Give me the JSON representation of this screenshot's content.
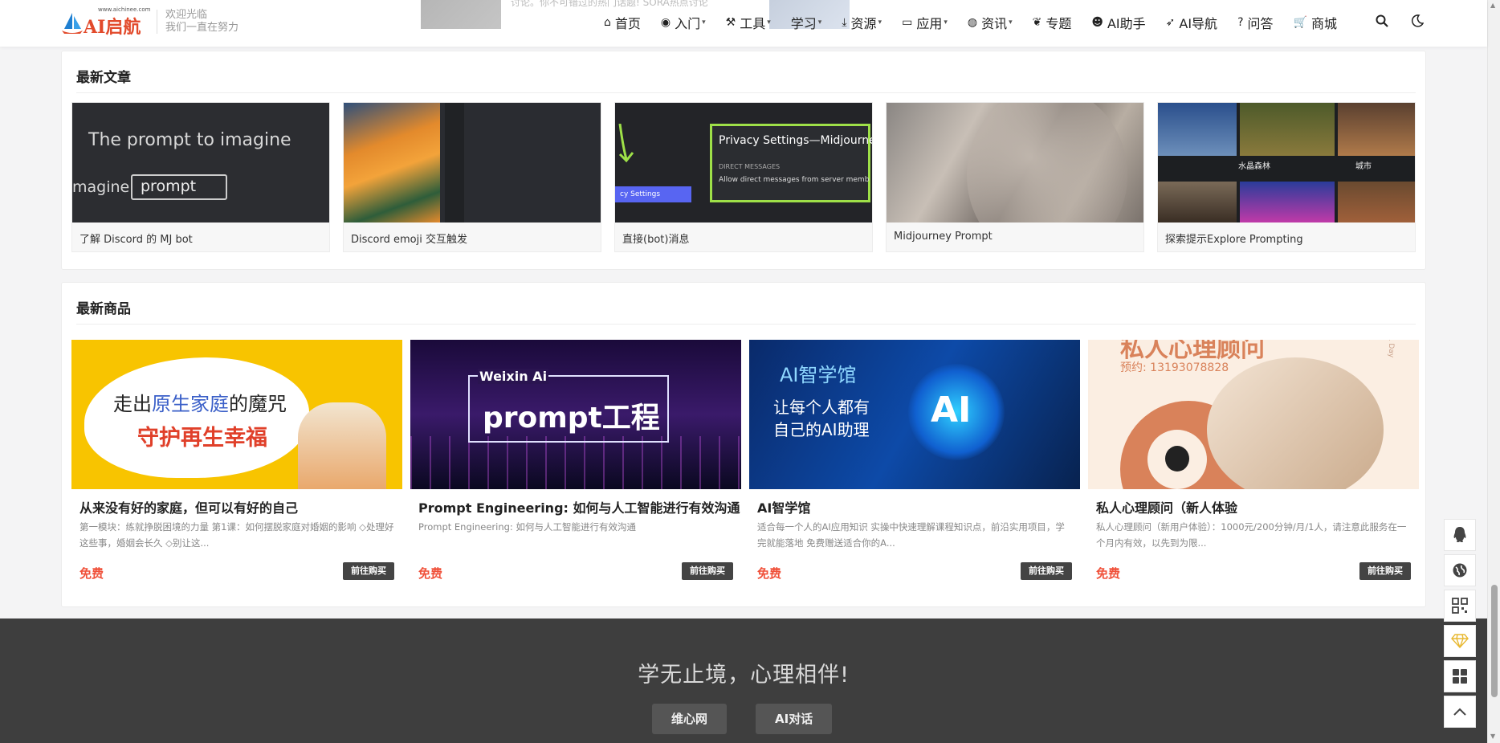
{
  "header": {
    "logo": {
      "url_text": "www.aichinee.com",
      "name": "AI启航"
    },
    "welcome": [
      "欢迎光临",
      "我们一直在努力"
    ],
    "promo_text": "讨论。你不可错过的热门话题! SORA热点讨论",
    "nav": [
      {
        "label": "首页",
        "icon": "home-icon",
        "dropdown": false
      },
      {
        "label": "入门",
        "icon": "eye-icon",
        "dropdown": true
      },
      {
        "label": "工具",
        "icon": "gavel-icon",
        "dropdown": true
      },
      {
        "label": "学习",
        "icon": "",
        "dropdown": true
      },
      {
        "label": "资源",
        "icon": "download-icon",
        "dropdown": true
      },
      {
        "label": "应用",
        "icon": "laptop-icon",
        "dropdown": true
      },
      {
        "label": "资讯",
        "icon": "globe-icon",
        "dropdown": true
      },
      {
        "label": "专题",
        "icon": "leaf-icon",
        "dropdown": false
      },
      {
        "label": "AI助手",
        "icon": "robot-icon",
        "dropdown": false
      },
      {
        "label": "AI导航",
        "icon": "rocket-icon",
        "dropdown": false
      },
      {
        "label": "问答",
        "icon": "question-icon",
        "dropdown": false
      },
      {
        "label": "商城",
        "icon": "cart-icon",
        "dropdown": false
      }
    ]
  },
  "articles": {
    "title": "最新文章",
    "items": [
      {
        "title": "了解 Discord 的 MJ bot",
        "thumb_text": [
          "The prompt to imagine",
          "magine",
          "prompt"
        ]
      },
      {
        "title": "Discord emoji 交互触发"
      },
      {
        "title": "直接(bot)消息",
        "thumb_text": [
          "Privacy Settings—Midjourney",
          "DIRECT MESSAGES",
          "Allow direct messages from server memb",
          "cy Settings"
        ]
      },
      {
        "title": "Midjourney Prompt"
      },
      {
        "title": "探索提示Explore Prompting",
        "thumb_text": [
          "水晶森林",
          "城市"
        ]
      }
    ]
  },
  "products": {
    "title": "最新商品",
    "items": [
      {
        "title": "从来没有好的家庭，但可以有好的自己",
        "desc": "第一模块：练就挣脱困境的力量 第1课：如何摆脱家庭对婚姻的影响 ◇处理好这些事，婚姻会长久 ◇别让这...",
        "price": "免费",
        "buy_label": "前往购买",
        "thumb_text": [
          "走出",
          "原生家庭",
          "的魔咒",
          "守护再生幸福"
        ]
      },
      {
        "title": "Prompt Engineering: 如何与人工智能进行有效沟通",
        "desc": "Prompt Engineering: 如何与人工智能进行有效沟通",
        "price": "免费",
        "buy_label": "前往购买",
        "thumb_text": [
          "Weixin Ai",
          "prompt工程"
        ]
      },
      {
        "title": "AI智学馆",
        "desc": "适合每一个人的AI应用知识 实操中快速理解课程知识点，前沿实用项目，学完就能落地 免费赠送适合你的A...",
        "price": "免费",
        "buy_label": "前往购买",
        "thumb_text": [
          "AI智学馆",
          "让每个人都有",
          "自己的AI助理",
          "AI"
        ]
      },
      {
        "title": "私人心理顾问（新人体验",
        "desc": "私人心理顾问（新用户体验）：1000元/200分钟/月/1人，请注意此服务在一个月内有效，以先到为限...",
        "price": "免费",
        "buy_label": "前往购买",
        "thumb_text": [
          "私人心理顾问",
          "预约: 13193078828",
          "1 Day"
        ]
      }
    ]
  },
  "footer": {
    "slogan": "学无止境，心理相伴!",
    "buttons": [
      "维心网",
      "AI对话"
    ]
  },
  "float_bar": [
    "qq-icon",
    "globe-icon",
    "qrcode-icon",
    "diamond-icon",
    "grid-icon",
    "arrow-up-icon"
  ],
  "colors": {
    "price": "#f0513a",
    "footer_bg": "#3e3e3e",
    "button_dark": "#444444"
  }
}
